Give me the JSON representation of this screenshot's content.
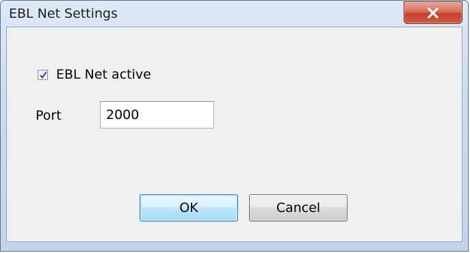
{
  "window": {
    "title": "EBL Net Settings",
    "close_icon": "close-icon",
    "close_color": "#c4402a"
  },
  "form": {
    "active_checkbox": {
      "label": "EBL Net active",
      "checked": true
    },
    "port": {
      "label": "Port",
      "value": "2000"
    }
  },
  "buttons": {
    "ok_label": "OK",
    "cancel_label": "Cancel"
  }
}
